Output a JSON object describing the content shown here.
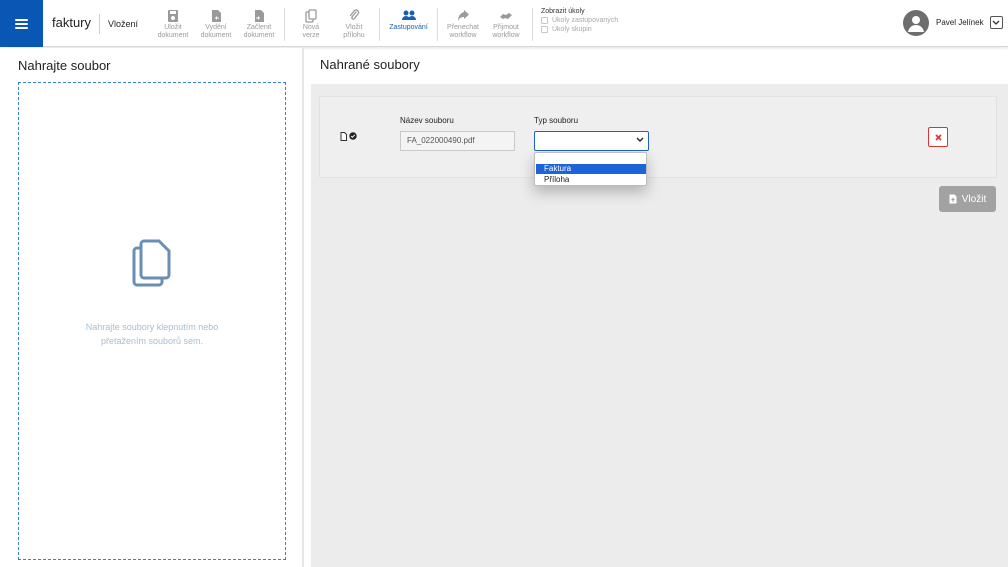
{
  "header": {
    "app_name": "faktury",
    "section": "Vložení",
    "toolbar": [
      {
        "id": "save",
        "label": "Uložit\ndokument",
        "icon": "save-icon",
        "active": false
      },
      {
        "id": "release",
        "label": "Vydění\ndokument",
        "icon": "document-export-icon",
        "active": false
      },
      {
        "id": "attach-doc",
        "label": "Začlenit\ndokument",
        "icon": "document-import-icon",
        "active": false
      },
      {
        "id": "new-version",
        "label": "Nová\nverze",
        "icon": "copy-icon",
        "active": false
      },
      {
        "id": "attach",
        "label": "Vložit\npřílohu",
        "icon": "paperclip-icon",
        "active": false
      },
      {
        "id": "substitute",
        "label": "Zastupování",
        "icon": "users-icon",
        "active": true
      },
      {
        "id": "transfer",
        "label": "Přenechat\nworkflow",
        "icon": "share-icon",
        "active": false
      },
      {
        "id": "accept",
        "label": "Přijmout\nworkflow",
        "icon": "handshake-icon",
        "active": false
      }
    ],
    "show_tasks": {
      "title": "Zobrazit úkoly",
      "options": [
        "Úkoly zastupovaných",
        "Úkoly skupin"
      ]
    },
    "user": {
      "name": "Pavel Jelínek"
    }
  },
  "left_panel": {
    "title": "Nahrajte soubor",
    "dropzone_text": "Nahrajte soubory klepnutím nebo\npřetažením souborů sem."
  },
  "right_panel": {
    "title": "Nahrané soubory",
    "file": {
      "name_label": "Název souboru",
      "name_value": "FA_022000490.pdf",
      "type_label": "Typ souboru",
      "type_value": "",
      "type_options": [
        "",
        "Faktura",
        "Příloha"
      ],
      "highlighted_option": "Faktura"
    },
    "insert_button": "Vložit"
  },
  "colors": {
    "brand": "#0a56b5",
    "active": "#1a5fb4",
    "danger": "#dd3333",
    "button_disabled": "#a2a2a2"
  }
}
